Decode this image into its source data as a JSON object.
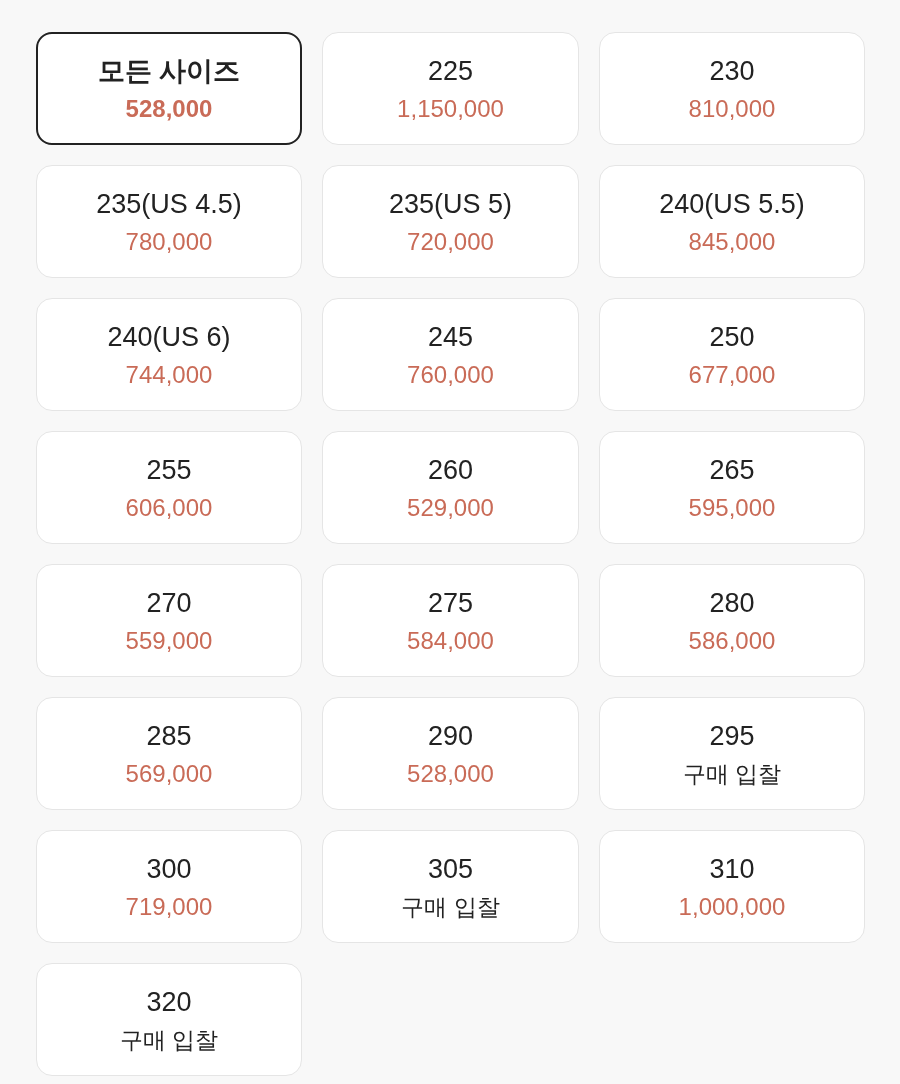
{
  "sizes": [
    {
      "label": "모든 사이즈",
      "price": "528,000",
      "kind": "price",
      "selected": true
    },
    {
      "label": "225",
      "price": "1,150,000",
      "kind": "price",
      "selected": false
    },
    {
      "label": "230",
      "price": "810,000",
      "kind": "price",
      "selected": false
    },
    {
      "label": "235(US 4.5)",
      "price": "780,000",
      "kind": "price",
      "selected": false
    },
    {
      "label": "235(US 5)",
      "price": "720,000",
      "kind": "price",
      "selected": false
    },
    {
      "label": "240(US 5.5)",
      "price": "845,000",
      "kind": "price",
      "selected": false
    },
    {
      "label": "240(US 6)",
      "price": "744,000",
      "kind": "price",
      "selected": false
    },
    {
      "label": "245",
      "price": "760,000",
      "kind": "price",
      "selected": false
    },
    {
      "label": "250",
      "price": "677,000",
      "kind": "price",
      "selected": false
    },
    {
      "label": "255",
      "price": "606,000",
      "kind": "price",
      "selected": false
    },
    {
      "label": "260",
      "price": "529,000",
      "kind": "price",
      "selected": false
    },
    {
      "label": "265",
      "price": "595,000",
      "kind": "price",
      "selected": false
    },
    {
      "label": "270",
      "price": "559,000",
      "kind": "price",
      "selected": false
    },
    {
      "label": "275",
      "price": "584,000",
      "kind": "price",
      "selected": false
    },
    {
      "label": "280",
      "price": "586,000",
      "kind": "price",
      "selected": false
    },
    {
      "label": "285",
      "price": "569,000",
      "kind": "price",
      "selected": false
    },
    {
      "label": "290",
      "price": "528,000",
      "kind": "price",
      "selected": false
    },
    {
      "label": "295",
      "price": "구매 입찰",
      "kind": "bid",
      "selected": false
    },
    {
      "label": "300",
      "price": "719,000",
      "kind": "price",
      "selected": false
    },
    {
      "label": "305",
      "price": "구매 입찰",
      "kind": "bid",
      "selected": false
    },
    {
      "label": "310",
      "price": "1,000,000",
      "kind": "price",
      "selected": false
    },
    {
      "label": "320",
      "price": "구매 입찰",
      "kind": "bid",
      "selected": false
    }
  ]
}
